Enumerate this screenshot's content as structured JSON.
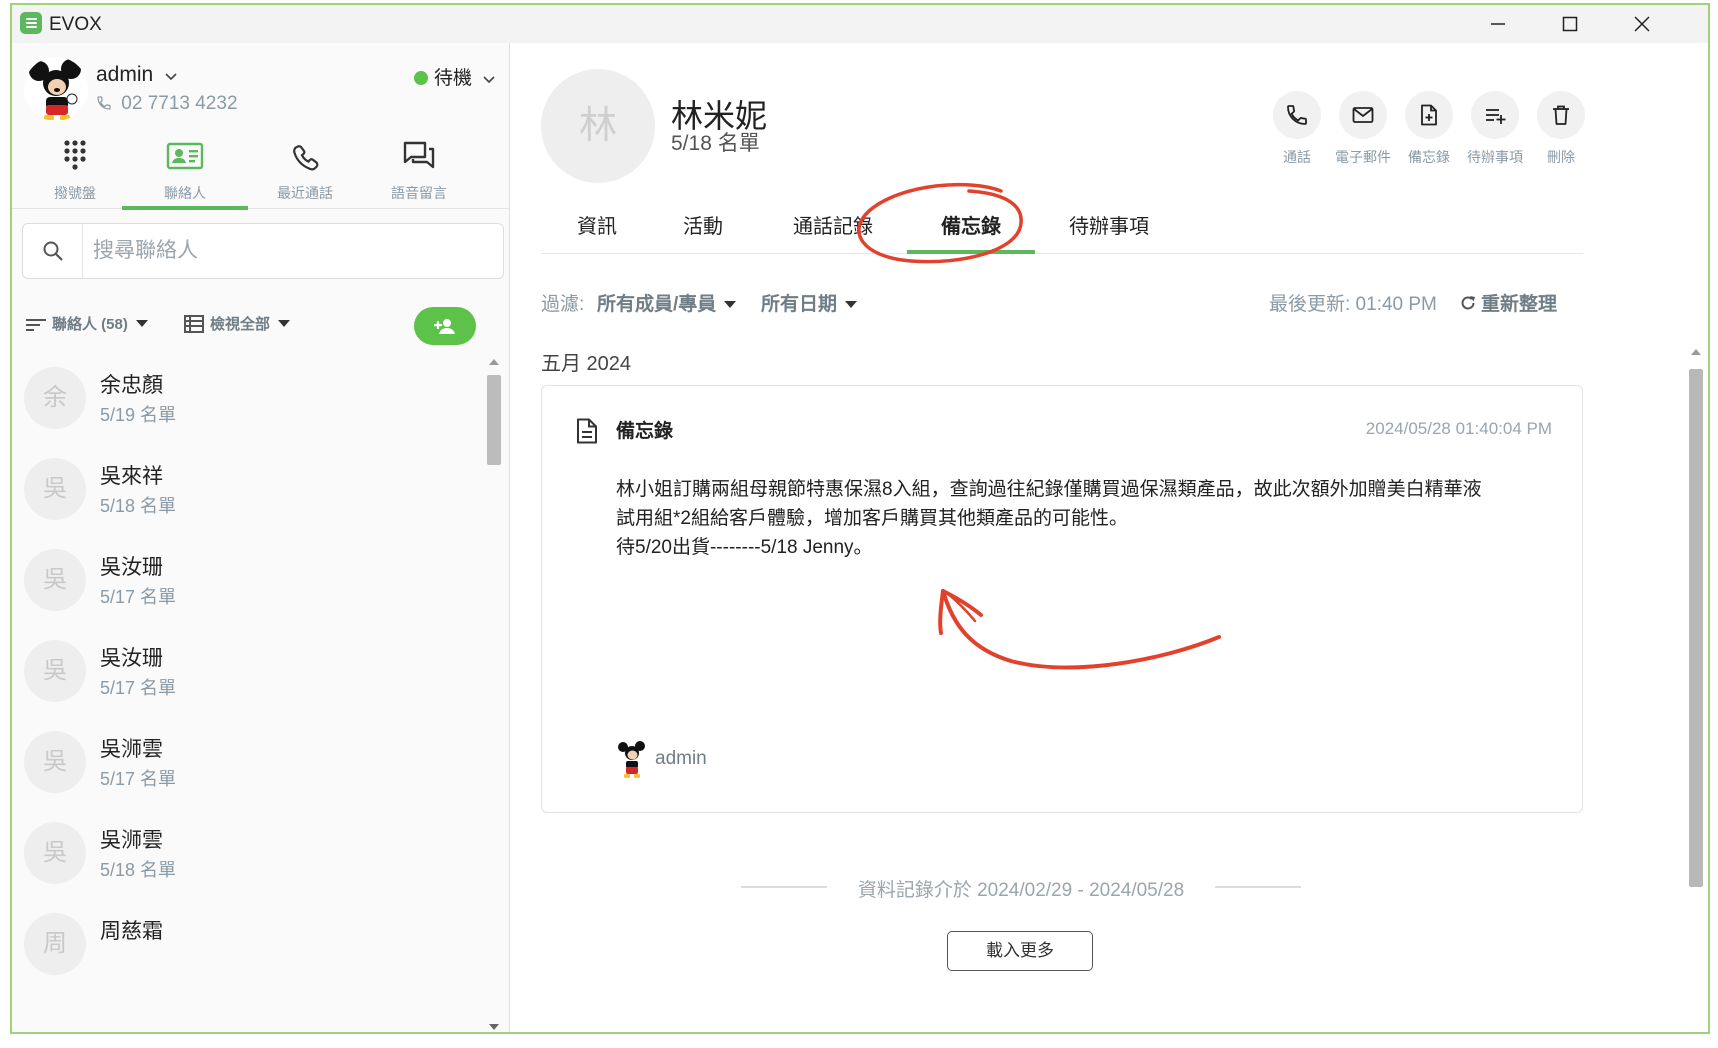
{
  "app": {
    "title": "EVOX"
  },
  "window_controls": {
    "minimize_icon": "minimize-icon",
    "maximize_icon": "maximize-icon",
    "close_icon": "close-icon"
  },
  "user": {
    "name": "admin",
    "extension": "02 7713 4232",
    "status": "待機",
    "status_color": "#5cc24a"
  },
  "nav": {
    "tabs": [
      {
        "label": "撥號盤",
        "icon": "dialpad-icon"
      },
      {
        "label": "聯絡人",
        "icon": "contact-card-icon",
        "active": true
      },
      {
        "label": "最近通話",
        "icon": "phone-icon"
      },
      {
        "label": "語音留言",
        "icon": "voicemail-chat-icon"
      }
    ]
  },
  "search": {
    "placeholder": "搜尋聯絡人",
    "value": ""
  },
  "list_toolbar": {
    "sort_label": "聯絡人 (58)",
    "view_label": "檢視全部"
  },
  "contacts": [
    {
      "initial": "余",
      "name": "余忠顏",
      "sub": "5/19 名單"
    },
    {
      "initial": "吳",
      "name": "吳來祥",
      "sub": "5/18 名單"
    },
    {
      "initial": "吳",
      "name": "吳汝珊",
      "sub": "5/17 名單"
    },
    {
      "initial": "吳",
      "name": "吳汝珊",
      "sub": "5/17 名單"
    },
    {
      "initial": "吳",
      "name": "吳浉雲",
      "sub": "5/17 名單"
    },
    {
      "initial": "吳",
      "name": "吳浉雲",
      "sub": "5/18 名單"
    },
    {
      "initial": "周",
      "name": "周慈霜",
      "sub": ""
    }
  ],
  "detail": {
    "initial": "林",
    "name": "林米妮",
    "sub": "5/18 名單",
    "actions": [
      {
        "label": "通話",
        "icon": "phone-icon"
      },
      {
        "label": "電子郵件",
        "icon": "mail-icon"
      },
      {
        "label": "備忘錄",
        "icon": "note-add-icon"
      },
      {
        "label": "待辦事項",
        "icon": "todo-add-icon"
      },
      {
        "label": "刪除",
        "icon": "trash-icon"
      }
    ],
    "tabs": [
      "資訊",
      "活動",
      "通話記錄",
      "備忘錄",
      "待辦事項"
    ],
    "active_tab": "備忘錄"
  },
  "filter": {
    "label": "過濾:",
    "members": "所有成員/專員",
    "dates": "所有日期",
    "last_updated": "最後更新: 01:40 PM",
    "refresh": "重新整理"
  },
  "month_label": "五月 2024",
  "memo": {
    "title": "備忘錄",
    "timestamp": "2024/05/28 01:40:04 PM",
    "body_line1": "林小姐訂購兩組母親節特惠保濕8入組，查詢過往紀錄僅購買過保濕類產品，故此次額外加贈美白精華液",
    "body_line2": "試用組*2組給客戶體驗，增加客戶購買其他類產品的可能性。",
    "body_line3": "待5/20出貨--------5/18 Jenny。",
    "author": "admin"
  },
  "range_text": "資料記錄介於 2024/02/29 - 2024/05/28",
  "load_more": "載入更多",
  "colors": {
    "accent": "#5cb85c",
    "annotation": "#e2412b",
    "border": "#9ed37a"
  }
}
